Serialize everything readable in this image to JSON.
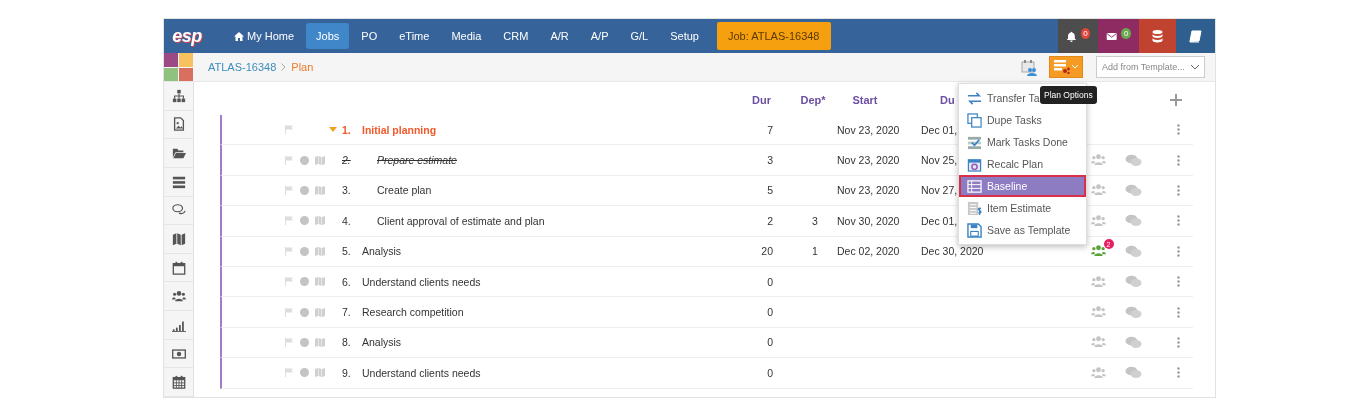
{
  "nav": {
    "logo": "esp",
    "items": [
      {
        "label": "My Home",
        "kind": "home",
        "selected": false
      },
      {
        "label": "Jobs",
        "selected": true
      },
      {
        "label": "PO",
        "selected": false
      },
      {
        "label": "eTime",
        "selected": false
      },
      {
        "label": "Media",
        "selected": false
      },
      {
        "label": "CRM",
        "selected": false
      },
      {
        "label": "A/R",
        "selected": false
      },
      {
        "label": "A/P",
        "selected": false
      },
      {
        "label": "G/L",
        "selected": false
      },
      {
        "label": "Setup",
        "selected": false
      }
    ],
    "job_button": "Job: ATLAS-16348",
    "notifications": [
      {
        "kind": "alerts",
        "count": "0",
        "color": "#e0463a"
      },
      {
        "kind": "messages",
        "count": "0",
        "color": "#6aa84f"
      }
    ]
  },
  "breadcrumb": [
    "ATLAS-16348",
    "Plan"
  ],
  "template_select": {
    "placeholder": "Add from Template..."
  },
  "columns": [
    "Dur",
    "Dep*",
    "Start",
    "Du"
  ],
  "tasks": [
    {
      "number": "1.",
      "name": "Initial planning",
      "kind": "group",
      "expanded": true,
      "dur": "7",
      "start": "Nov 23, 2020",
      "due": "Dec 01,",
      "children": [
        {
          "number": "2.",
          "name": "Prepare estimate",
          "kind": "task",
          "done": true,
          "assigned": false,
          "dur": "3",
          "start": "Nov 23, 2020",
          "due": "Nov 25,"
        },
        {
          "number": "3.",
          "name": "Create plan",
          "kind": "task",
          "done": false,
          "assigned": false,
          "dur": "5",
          "start": "Nov 23, 2020",
          "due": "Nov 27,"
        },
        {
          "number": "4.",
          "name": "Client approval of estimate and plan",
          "kind": "task",
          "done": false,
          "assigned": false,
          "dur": "2",
          "dep": "3",
          "start": "Nov 30, 2020",
          "due": "Dec 01,"
        }
      ]
    },
    {
      "number": "5.",
      "name": "Analysis",
      "kind": "task",
      "done": false,
      "dur": "20",
      "dep": "1",
      "start": "Dec 02, 2020",
      "due": "Dec 30, 2020",
      "assigned": true,
      "assignee_count": "2"
    },
    {
      "number": "6.",
      "name": "Understand clients needs",
      "kind": "task",
      "done": false,
      "assigned": false,
      "dur": "0"
    },
    {
      "number": "7.",
      "name": "Research competition",
      "kind": "task",
      "done": false,
      "assigned": false,
      "dur": "0"
    },
    {
      "number": "8.",
      "name": "Analysis",
      "kind": "task",
      "done": false,
      "assigned": false,
      "dur": "0"
    },
    {
      "number": "9.",
      "name": "Understand clients needs",
      "kind": "task",
      "done": false,
      "assigned": false,
      "dur": "0"
    }
  ],
  "plan_menu": {
    "tooltip": "Plan Options",
    "items": [
      {
        "label": "Transfer Ta",
        "selected": false
      },
      {
        "label": "Dupe Tasks",
        "selected": false
      },
      {
        "label": "Mark Tasks Done",
        "selected": false
      },
      {
        "label": "Recalc Plan",
        "selected": false
      },
      {
        "label": "Baseline",
        "selected": true
      },
      {
        "label": "Item Estimate",
        "selected": false
      },
      {
        "label": "Save as Template",
        "selected": false
      }
    ]
  }
}
